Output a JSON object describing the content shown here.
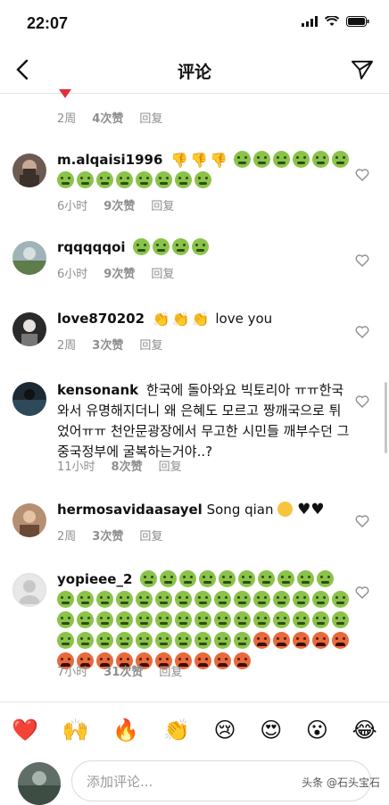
{
  "status": {
    "time": "22:07"
  },
  "nav": {
    "title": "评论"
  },
  "top_partial": {
    "time": "2周",
    "likes": "4次赞",
    "reply": "回复"
  },
  "comments": [
    {
      "username": "m.alqaisi1996",
      "text": "",
      "time": "6小时",
      "likes": "9次赞",
      "reply": "回复"
    },
    {
      "username": "rqqqqqoi",
      "text": "",
      "time": "6小时",
      "likes": "9次赞",
      "reply": "回复"
    },
    {
      "username": "love870202",
      "text": "love you",
      "time": "2周",
      "likes": "3次赞",
      "reply": "回复"
    },
    {
      "username": "kensonank",
      "text": "한국에 돌아와요 빅토리아 ㅠㅠ한국와서 유명해지더니 왜 은혜도 모르고 짱깨국으로 튀었어ㅠㅠ 천안문광장에서 무고한 시민들 깨부수던 그 중국정부에 굴복하는거야..?",
      "time": "11小时",
      "likes": "8次赞",
      "reply": "回复"
    },
    {
      "username": "hermosavidaasayel",
      "text": "Song qian",
      "time": "2周",
      "likes": "3次赞",
      "reply": "回复"
    },
    {
      "username": "yopieee_2",
      "text": "",
      "time": "7小时",
      "likes": "31次赞",
      "reply": "回复"
    }
  ],
  "emoji_bar": [
    "❤️",
    "🙌",
    "🔥",
    "👏",
    "😢",
    "😍",
    "😮",
    "😂"
  ],
  "input": {
    "placeholder": "添加评论..."
  },
  "watermark": "头条 @石头宝石",
  "colors": {
    "meta": "#8e8e8e",
    "sick_emoji": "#8bc34a",
    "angry_emoji": "#e76a3c"
  }
}
